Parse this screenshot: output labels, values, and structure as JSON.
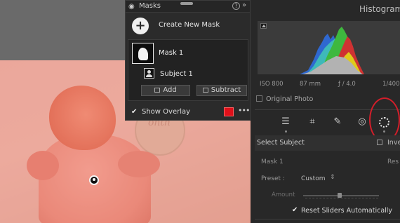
{
  "masks_panel": {
    "title": "Masks",
    "help_glyph": "?",
    "collapse_glyph": "»",
    "create_label": "Create New Mask",
    "plus_glyph": "+",
    "mask_name": "Mask 1",
    "subject_name": "Subject 1",
    "add_label": "Add",
    "subtract_label": "Subtract",
    "show_overlay_label": "Show Overlay",
    "show_overlay_checked": true,
    "check_glyph": "✔",
    "overlay_color": "#e0101a",
    "more_glyph": "•••"
  },
  "canvas": {
    "plaque_text": "onth"
  },
  "histogram": {
    "title": "Histogram",
    "iso": "ISO 800",
    "focal": "87 mm",
    "aperture": "ƒ / 4.0",
    "shutter": "1/400",
    "original_photo_label": "Original Photo"
  },
  "tools": {
    "edit_icon": "sliders-icon",
    "crop_icon": "crop-icon",
    "heal_icon": "bandage-icon",
    "redeye_icon": "eye-icon",
    "mask_icon": "masking-icon"
  },
  "subject_panel": {
    "title": "Select Subject",
    "invert_label": "Inve",
    "mask_label": "Mask 1",
    "reset_label": "Res",
    "preset_label": "Preset :",
    "preset_value": "Custom",
    "preset_caret": "⇕",
    "amount_label": "Amount",
    "reset_sliders_label": "Reset Sliders Automatically",
    "reset_sliders_checked": true
  }
}
